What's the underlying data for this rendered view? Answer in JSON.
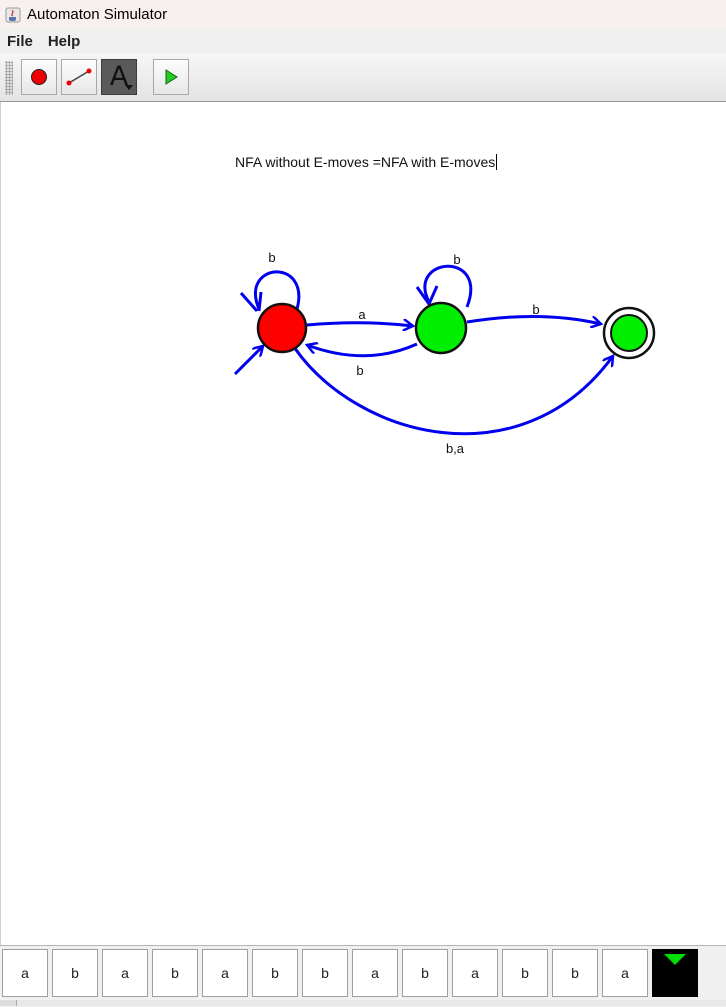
{
  "window": {
    "title": "Automaton Simulator"
  },
  "menu": {
    "file": "File",
    "help": "Help"
  },
  "toolbar": {
    "tools": [
      "state-tool",
      "transition-tool",
      "text-tool",
      "run-tool"
    ],
    "selected_tool": "text-tool",
    "text_tool_glyph": "A"
  },
  "canvas": {
    "caption": "NFA without E-moves =NFA with E-moves",
    "states": [
      {
        "id": "q0",
        "fill": "#ff0000",
        "initial": true,
        "accepting": false
      },
      {
        "id": "q1",
        "fill": "#00ee00",
        "initial": false,
        "accepting": false
      },
      {
        "id": "q2",
        "fill": "#00ee00",
        "initial": false,
        "accepting": true
      }
    ],
    "transitions": [
      {
        "from": "q0",
        "to": "q0",
        "label": "b"
      },
      {
        "from": "q0",
        "to": "q1",
        "label": "a"
      },
      {
        "from": "q1",
        "to": "q0",
        "label": "b"
      },
      {
        "from": "q1",
        "to": "q1",
        "label": "b"
      },
      {
        "from": "q1",
        "to": "q2",
        "label": "b"
      },
      {
        "from": "q0",
        "to": "q2",
        "label": "b,a"
      }
    ],
    "edge_color": "#0000ee"
  },
  "tape": {
    "cells": [
      "a",
      "b",
      "a",
      "b",
      "a",
      "b",
      "b",
      "a",
      "b",
      "a",
      "b",
      "b",
      "a"
    ],
    "head_color": "#000000",
    "head_marker_color": "#00dd00"
  }
}
